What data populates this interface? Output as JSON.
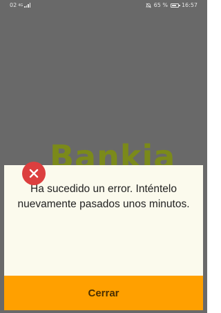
{
  "status_bar": {
    "network": "02",
    "network_type": "4G",
    "battery": "65 %",
    "time": "16:57",
    "icons": [
      "signal-icon",
      "alarm-off-icon",
      "battery-icon"
    ]
  },
  "background": {
    "logo_text": "Bankia"
  },
  "dialog": {
    "icon": "error-x-icon",
    "message": "Ha sucedido un error. Inténtelo nuevamente pasados unos minutos.",
    "button_label": "Cerrar",
    "colors": {
      "accent": "#ffa000",
      "error": "#dc3f3f",
      "dialog_bg": "#fbfaed",
      "overlay": "#696969"
    }
  }
}
